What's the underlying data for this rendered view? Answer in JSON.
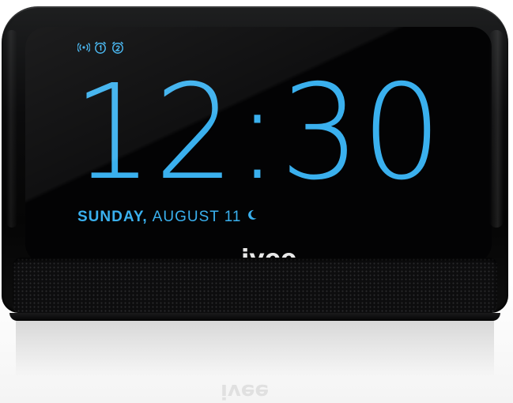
{
  "status_icons": [
    "wireless-icon",
    "alarm-1-icon",
    "alarm-2-icon"
  ],
  "clock": {
    "time": "12:30",
    "day": "SUNDAY,",
    "date": "AUGUST 11"
  },
  "night_mode_icon": "moon-icon",
  "brand": {
    "name": "ivee"
  },
  "colors": {
    "display_blue": "#3ab0ee",
    "body_black": "#0b0b0c",
    "logo_white": "#e8e8e8"
  }
}
